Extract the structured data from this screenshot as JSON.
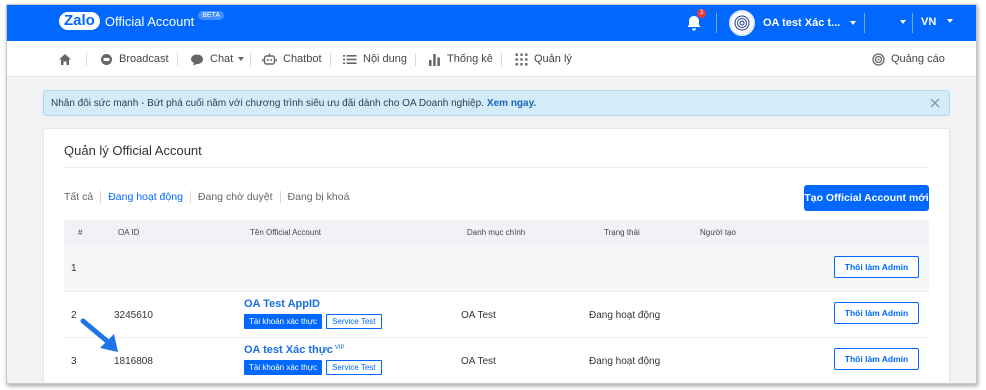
{
  "header": {
    "logo": "Zalo",
    "product": "Official Account",
    "beta": "BETA",
    "notification_count": "3",
    "account_name": "OA test Xác t...",
    "language": "VN",
    "bar_color": "#0068ff"
  },
  "nav": {
    "home_icon": "home-icon",
    "items": [
      {
        "label": "Broadcast",
        "icon": "broadcast-icon"
      },
      {
        "label": "Chat",
        "icon": "chat-icon"
      },
      {
        "label": "Chatbot",
        "icon": "chatbot-icon"
      },
      {
        "label": "Nội dung",
        "icon": "list-icon"
      },
      {
        "label": "Thống kê",
        "icon": "bar-chart-icon"
      },
      {
        "label": "Quản lý",
        "icon": "grid-icon"
      }
    ],
    "ads_label": "Quảng cáo"
  },
  "notice": {
    "text": "Nhân đôi sức mạnh - Bứt phá cuối năm với chương trình siêu ưu đãi dành cho OA Doanh nghiệp.",
    "link": "Xem ngay."
  },
  "card": {
    "title": "Quản lý Official Account",
    "filters": [
      "Tất cả",
      "Đang hoạt động",
      "Đang chờ duyệt",
      "Đang bị khoá"
    ],
    "active_filter": "Đang hoạt động",
    "create_button": "Tạo Official Account mới"
  },
  "table": {
    "headers": {
      "index": "#",
      "oa_id": "OA ID",
      "name": "Tên Official Account",
      "category": "Danh mục chính",
      "status": "Trạng thái",
      "creator": "Người tạo"
    },
    "rows": [
      {
        "index": "1",
        "oa_id": "",
        "name": "",
        "category": "",
        "status": "",
        "creator": "",
        "action": "Thôi làm Admin"
      },
      {
        "index": "2",
        "oa_id": "3245610",
        "name": "OA Test AppID",
        "vip": "",
        "tag1": "Tài khoản xác thực",
        "tag2": "Service Test",
        "category": "OA Test",
        "status": "Đang hoạt động",
        "creator": "",
        "action": "Thôi làm Admin"
      },
      {
        "index": "3",
        "oa_id": "1816808",
        "name": "OA test Xác thực",
        "vip": "VIP",
        "tag1": "Tài khoản xác thực",
        "tag2": "Service Test",
        "category": "OA Test",
        "status": "Đang hoạt động",
        "creator": "",
        "action": "Thôi làm Admin"
      }
    ]
  }
}
